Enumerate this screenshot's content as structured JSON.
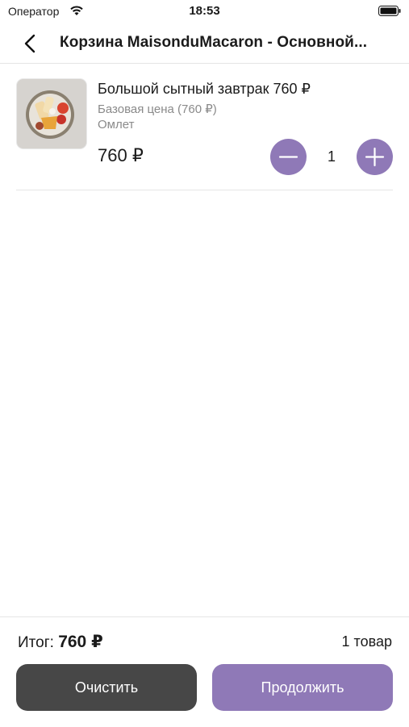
{
  "status_bar": {
    "carrier": "Оператор",
    "time": "18:53"
  },
  "nav": {
    "title": "Корзина MaisonduMacaron - Основной..."
  },
  "cart": {
    "items": [
      {
        "name": "Большой сытный завтрак 760 ₽",
        "base_price": "Базовая цена (760 ₽)",
        "modifier": "Омлет",
        "price": "760 ₽",
        "quantity": "1",
        "image_icon": "breakfast-plate-icon"
      }
    ]
  },
  "footer": {
    "total_label": "Итог:",
    "total_value": "760 ₽",
    "items_count": "1 товар",
    "clear_label": "Очистить",
    "continue_label": "Продолжить"
  },
  "colors": {
    "accent": "#8f79b7",
    "dark_button": "#474747",
    "secondary_text": "#8a8a8a"
  }
}
